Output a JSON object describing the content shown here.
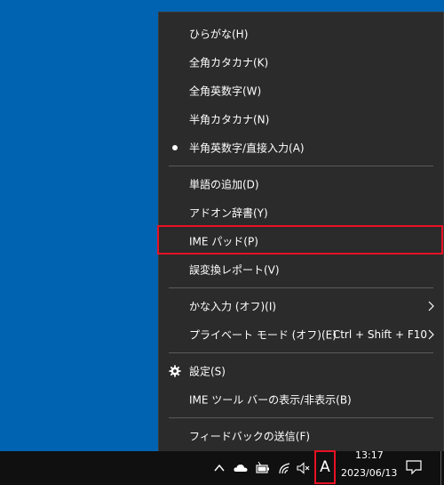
{
  "menu": {
    "items": [
      {
        "label": "ひらがな(H)"
      },
      {
        "label": "全角カタカナ(K)"
      },
      {
        "label": "全角英数字(W)"
      },
      {
        "label": "半角カタカナ(N)"
      },
      {
        "label": "半角英数字/直接入力(A)",
        "selected": true
      },
      {
        "label": "単語の追加(D)"
      },
      {
        "label": "アドオン辞書(Y)"
      },
      {
        "label": "IME パッド(P)",
        "highlighted": true
      },
      {
        "label": "誤変換レポート(V)"
      },
      {
        "label": "かな入力 (オフ)(I)",
        "submenu": true
      },
      {
        "label": "プライベート モード (オフ)(E)",
        "shortcut": "Ctrl + Shift + F10",
        "submenu": true
      },
      {
        "label": "設定(S)",
        "icon": "gear-icon"
      },
      {
        "label": "IME ツール バーの表示/非表示(B)"
      },
      {
        "label": "フィードバックの送信(F)"
      }
    ]
  },
  "taskbar": {
    "ime_mode": "A",
    "time": "13:17",
    "date": "2023/06/13",
    "icons": [
      "chevron-up-icon",
      "cloud-icon",
      "battery-icon",
      "wifi-icon",
      "speaker-muted-icon",
      "notification-icon"
    ]
  },
  "colors": {
    "desktop": "#0063b1",
    "menu_bg": "#2b2b2b",
    "taskbar": "#101010",
    "highlight_border": "#e81123"
  }
}
